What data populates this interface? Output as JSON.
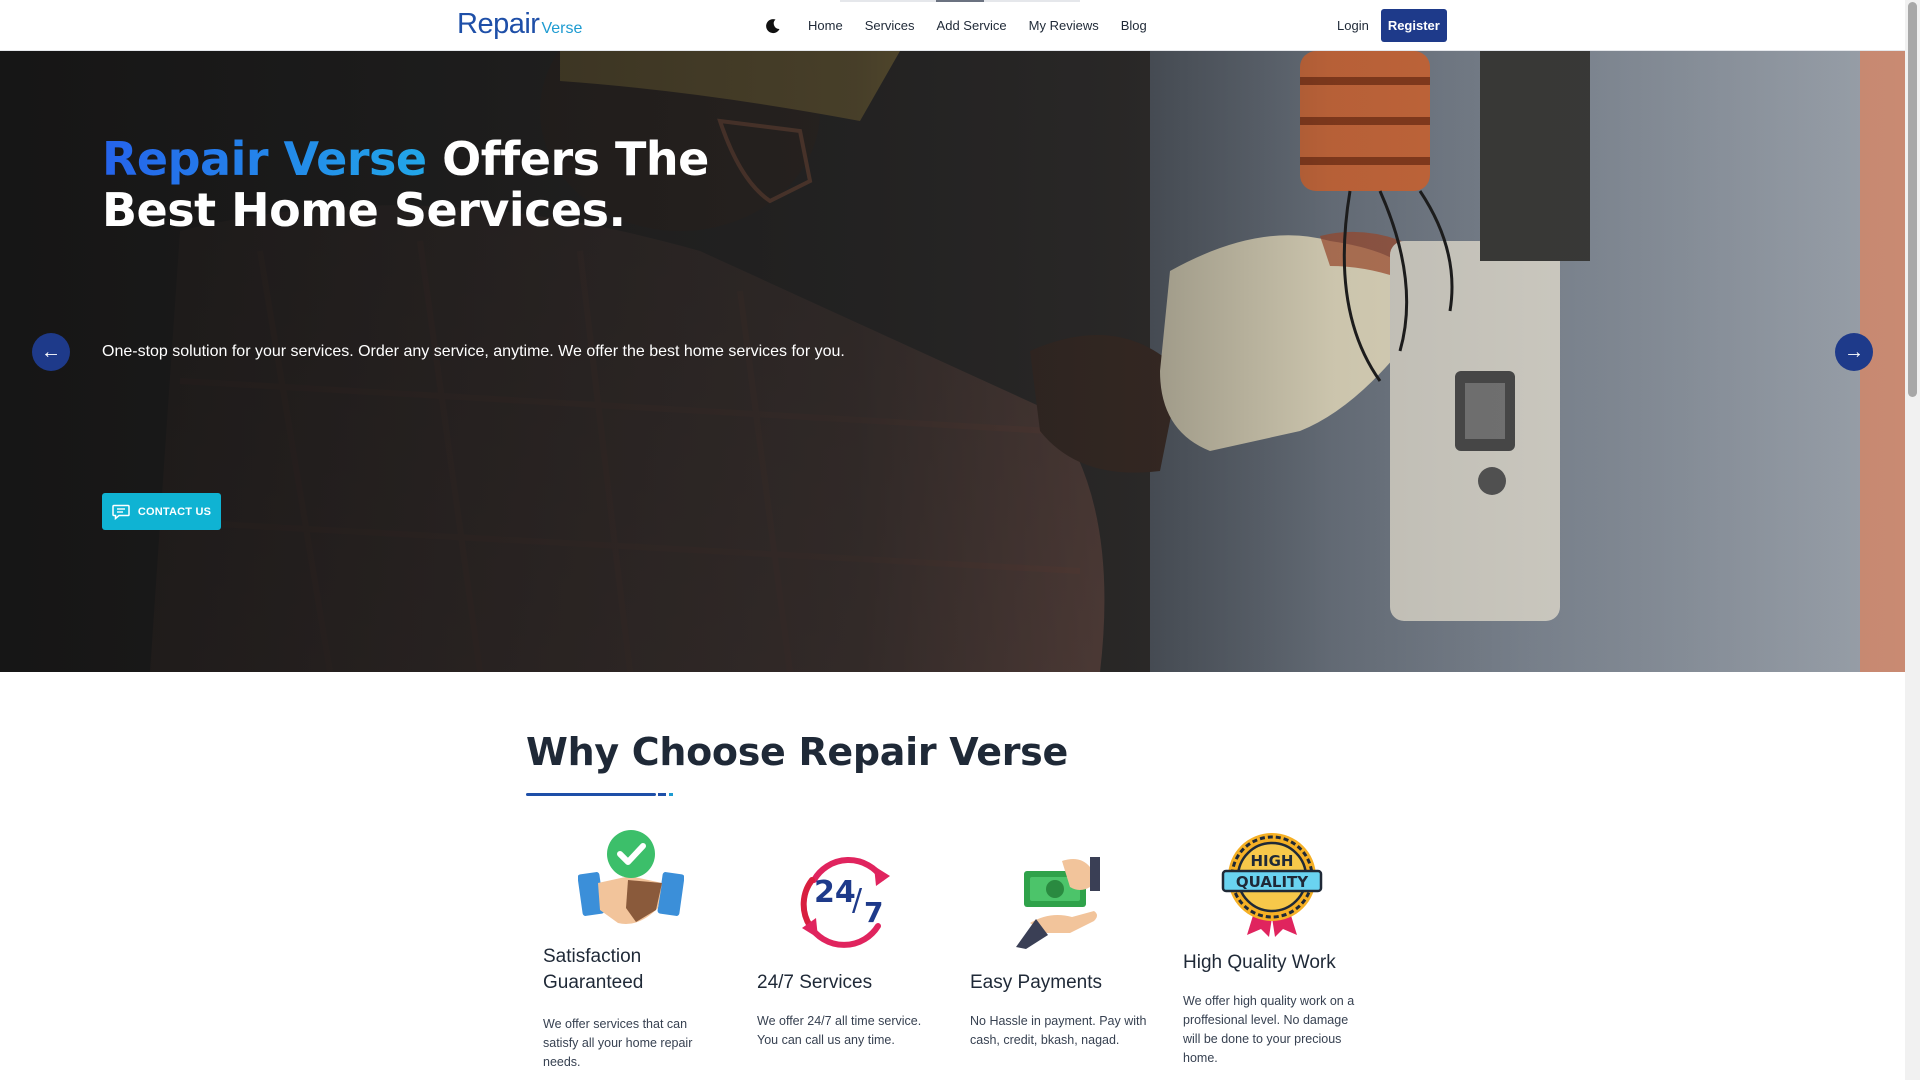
{
  "nav": {
    "logo_main": "Repair",
    "logo_sub": "Verse",
    "theme_icon": "moon-icon",
    "links": [
      "Home",
      "Services",
      "Add Service",
      "My Reviews",
      "Blog"
    ],
    "login": "Login",
    "register": "Register"
  },
  "hero": {
    "title_brand": "Repair Verse",
    "title_rest": " Offers The Best Home Services.",
    "subtitle": "One-stop solution for your services. Order any service, anytime. We offer the best home services for you.",
    "contact_label": "CONTACT US",
    "prev_arrow": "←",
    "next_arrow": "→"
  },
  "why": {
    "title": "Why Choose Repair Verse",
    "features": [
      {
        "icon": "handshake-check-icon",
        "title": "Satisfaction Guaranteed",
        "text": "We offer services that can satisfy all your home repair needs."
      },
      {
        "icon": "24-7-icon",
        "title": "24/7 Services",
        "text": "We offer 24/7 all time service. You can call us any time."
      },
      {
        "icon": "payment-hand-icon",
        "title": "Easy Payments",
        "text": "No Hassle in payment. Pay with cash, credit, bkash, nagad."
      },
      {
        "icon": "high-quality-badge-icon",
        "title": "High Quality Work",
        "text": "We offer high quality work on a proffesional level. No damage will be done to your precious home.",
        "badge_line1": "HIGH",
        "badge_line2": "QUALITY"
      }
    ]
  },
  "colors": {
    "brand_dark": "#1e3a8a",
    "brand_blue": "#1e4fa8",
    "accent_cyan": "#0fb3d3"
  }
}
